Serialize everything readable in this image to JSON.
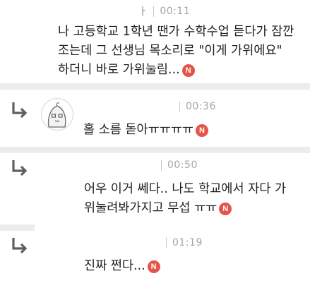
{
  "comments": [
    {
      "id": "c1",
      "user_mark": "ㅏ",
      "time": "00:11",
      "lines": [
        "나 고등학교 1학년 땐가 수학수업 듣다가 잠깐",
        "조는데 그 선생님 목소리로 \"이게 가위에요\"",
        "하더니 바로 가위눌림..."
      ],
      "new_badge": "N"
    },
    {
      "id": "c2",
      "time": "00:36",
      "lines": [
        "홀 소름 돋아ㅠㅠㅠㅠ"
      ],
      "new_badge": "N"
    },
    {
      "id": "c3",
      "time": "00:50",
      "lines": [
        "어우 이거 쎄다.. 나도 학교에서 자다 가",
        "위눌려봐가지고 무섭 ㅠㅠ"
      ],
      "new_badge": "N"
    },
    {
      "id": "c4",
      "time": "01:19",
      "lines": [
        "진짜 쩐다..."
      ],
      "new_badge": "N"
    }
  ],
  "colors": {
    "badge": "#e3554a",
    "separator": "#ececec",
    "meta_text": "#a5a5a5"
  },
  "icons": {
    "reply": "reply-arrow-icon",
    "avatar": "default-avatar-icon",
    "new": "new-badge-icon"
  }
}
